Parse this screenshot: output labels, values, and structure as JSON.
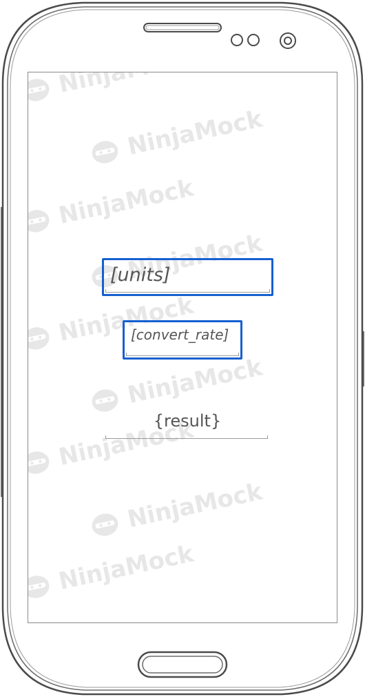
{
  "watermark": {
    "text": "NinjaMock",
    "color": "#e7e7e7"
  },
  "form": {
    "units_placeholder": "[units]",
    "convert_rate_placeholder": "[convert_rate]",
    "result_label": "{result}"
  },
  "colors": {
    "field_border": "#1560d0",
    "device_outline": "#555555"
  },
  "icons": {
    "speaker": "speaker-grille-icon",
    "sensor_left": "sensor-icon",
    "sensor_right": "sensor-icon",
    "camera": "front-camera-icon",
    "home": "home-button-icon"
  }
}
